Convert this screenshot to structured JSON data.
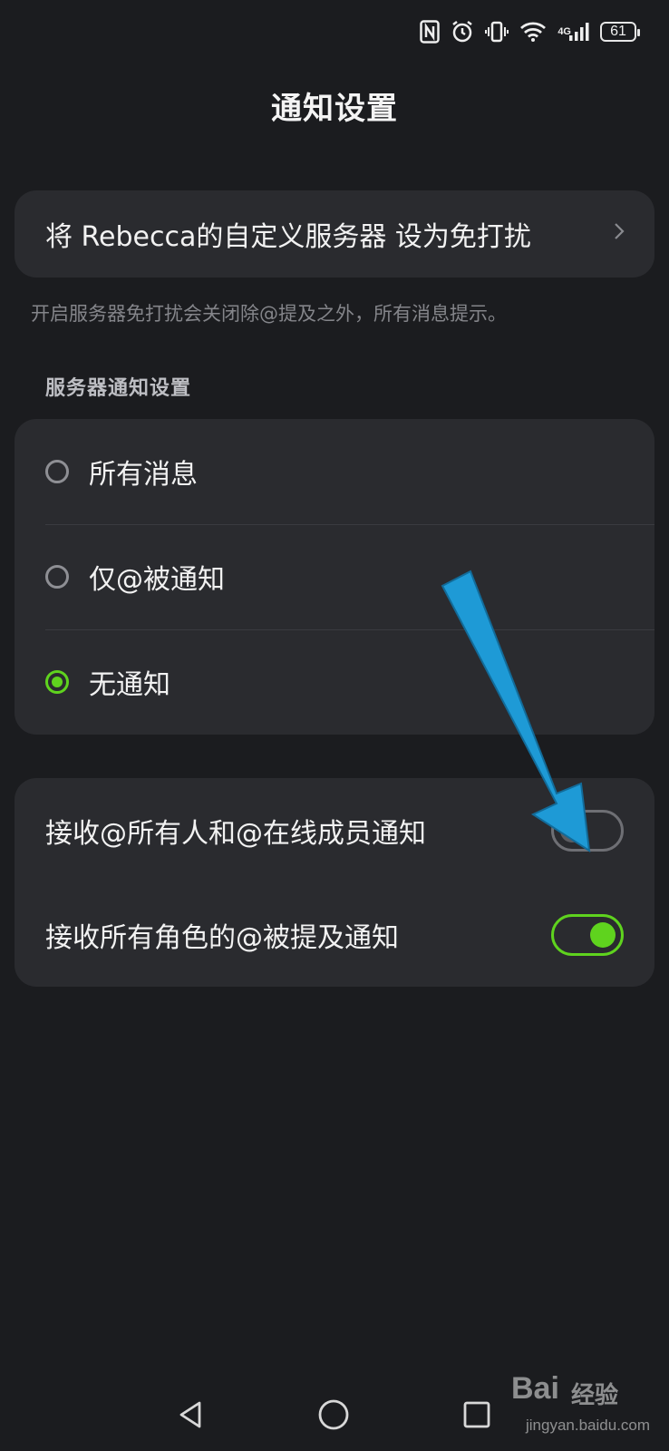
{
  "status_bar": {
    "icons": [
      "nfc-icon",
      "alarm-icon",
      "vibrate-icon",
      "wifi-icon",
      "signal-icon"
    ],
    "network_label": "4G",
    "battery": "61"
  },
  "page": {
    "title": "通知设置"
  },
  "dnd": {
    "label": "将 Rebecca的自定义服务器 设为免打扰",
    "hint": "开启服务器免打扰会关闭除@提及之外，所有消息提示。"
  },
  "server_notifications": {
    "section_title": "服务器通知设置",
    "options": [
      {
        "label": "所有消息",
        "selected": false
      },
      {
        "label": "仅@被通知",
        "selected": false
      },
      {
        "label": "无通知",
        "selected": true
      }
    ]
  },
  "toggles": [
    {
      "label": "接收@所有人和@在线成员通知",
      "on": false
    },
    {
      "label": "接收所有角色的@被提及通知",
      "on": true
    }
  ],
  "annotation": {
    "color": "#1e9ad6",
    "icon": "arrow-pointer-icon"
  },
  "colors": {
    "accent": "#5fd31e",
    "background": "#1b1c1f",
    "card": "#2a2b2f"
  },
  "nav": {
    "icons": [
      "back-icon",
      "home-icon",
      "recent-apps-icon"
    ]
  },
  "watermark": {
    "brand": "Bai",
    "sub": "经验",
    "domain": "jingyan.baidu.com"
  }
}
